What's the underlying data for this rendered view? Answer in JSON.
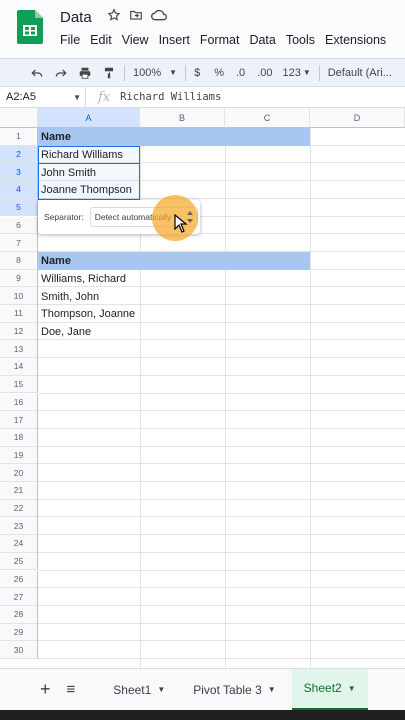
{
  "app": {
    "title": "Data",
    "menus": [
      "File",
      "Edit",
      "View",
      "Insert",
      "Format",
      "Data",
      "Tools",
      "Extensions"
    ]
  },
  "toolbar": {
    "zoom": "100%",
    "currency": "$",
    "percent": "%",
    "decrease_decimal": ".0",
    "increase_decimal": ".00",
    "number_format": "123",
    "font": "Default (Ari..."
  },
  "formula_bar": {
    "range": "A2:A5",
    "fx": "fx",
    "value": "Richard Williams"
  },
  "columns": [
    "A",
    "B",
    "C",
    "D"
  ],
  "rows": [
    "1",
    "2",
    "3",
    "4",
    "5",
    "6",
    "7",
    "8",
    "9",
    "10",
    "11",
    "12",
    "13",
    "14",
    "15",
    "16",
    "17",
    "18",
    "19",
    "20",
    "21",
    "22",
    "23",
    "24",
    "25",
    "26",
    "27",
    "28",
    "29",
    "30"
  ],
  "cells": {
    "a1": "Name",
    "a2": "Richard Williams",
    "a3": "John Smith",
    "a4": "Joanne Thompson",
    "a8": "Name",
    "a9": "Williams, Richard",
    "a10": "Smith, John",
    "a11": "Thompson, Joanne",
    "a12": "Doe, Jane"
  },
  "separator_popup": {
    "label": "Separator:",
    "value": "Detect automatically"
  },
  "sheets": {
    "add": "+",
    "list": "≡",
    "tabs": [
      "Sheet1",
      "Pivot Table 3",
      "Sheet2"
    ],
    "active": "Sheet2"
  },
  "colors": {
    "header_fill": "#a8c7f0",
    "selection": "#1a73e8",
    "active_tab": "#146c2e",
    "brand": "#0f9d58"
  }
}
